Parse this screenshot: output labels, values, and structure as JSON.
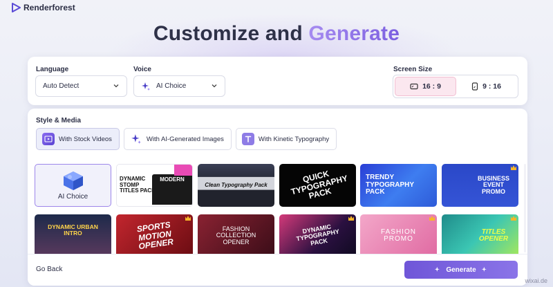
{
  "brand": {
    "name": "Renderforest",
    "logo_icon": "play-triangle-icon",
    "color": "#6f56d8"
  },
  "headline": {
    "part1": "Customize and",
    "part2": "Generate"
  },
  "settings": {
    "language": {
      "label": "Language",
      "value": "Auto Detect"
    },
    "voice": {
      "label": "Voice",
      "value": "AI Choice",
      "icon": "sparkle-icon"
    },
    "screen_size": {
      "label": "Screen Size",
      "options": [
        {
          "label": "16 : 9",
          "active": true,
          "icon": "landscape-icon"
        },
        {
          "label": "9 : 16",
          "active": false,
          "icon": "portrait-icon"
        }
      ]
    }
  },
  "style_media": {
    "label": "Style & Media",
    "tabs": [
      {
        "label": "With Stock Videos",
        "active": true,
        "icon": "film-icon"
      },
      {
        "label": "With AI-Generated Images",
        "active": false,
        "icon": "sparkle-icon"
      },
      {
        "label": "With Kinetic Typography",
        "active": false,
        "icon": "type-icon"
      }
    ]
  },
  "templates": {
    "ai_choice_label": "AI Choice",
    "row1": [
      {
        "text": "DYNAMIC STOMP TITLES PACK",
        "subtext": "MODERN",
        "badge": false
      },
      {
        "text": "Clean Typography Pack",
        "badge": false
      },
      {
        "text": "QUICK TYPOGRAPHY PACK",
        "badge": false
      },
      {
        "text": "TRENDY TYPOGRAPHY PACK",
        "badge": false
      },
      {
        "text": "BUSINESS EVENT PROMO",
        "badge": true
      }
    ],
    "row2": [
      {
        "text": "DYNAMIC URBAN INTRO",
        "badge": false
      },
      {
        "text": "SPORTS MOTION OPENER",
        "badge": true
      },
      {
        "text": "FASHION COLLECTION OPENER",
        "badge": false
      },
      {
        "text": "DYNAMIC TYPOGRAPHY PACK",
        "badge": true
      },
      {
        "text": "FASHION PROMO",
        "badge": true
      },
      {
        "text": "TITLES OPENER",
        "badge": true
      }
    ]
  },
  "footer": {
    "go_back": "Go Back",
    "generate": "Generate"
  },
  "watermark": "wixai.de"
}
